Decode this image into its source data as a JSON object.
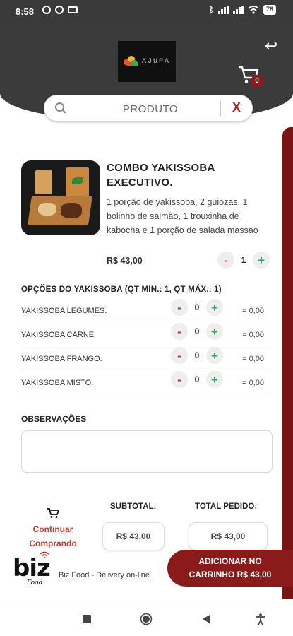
{
  "status_bar": {
    "time": "8:58",
    "battery": "78"
  },
  "header": {
    "logo_text": "AJUPA",
    "cart_count": "0"
  },
  "search": {
    "placeholder": "PRODUTO",
    "clear_label": "X"
  },
  "product": {
    "title": "COMBO YAKISSOBA EXECUTIVO.",
    "description": "1 porção de yakissoba, 2 guiozas, 1 bolinho de salmão, 1 trouxinha de kabocha e 1 porção de salada massao",
    "price": "R$ 43,00",
    "quantity": "1"
  },
  "options": {
    "title": "OPÇÕES DO YAKISSOBA (QT MIN.: 1, QT MÁX.: 1)",
    "items": [
      {
        "name": "YAKISSOBA LEGUMES.",
        "qty": "0",
        "total": "= 0,00"
      },
      {
        "name": "YAKISSOBA CARNE.",
        "qty": "0",
        "total": "= 0,00"
      },
      {
        "name": "YAKISSOBA FRANGO.",
        "qty": "0",
        "total": "= 0,00"
      },
      {
        "name": "YAKISSOBA MISTO.",
        "qty": "0",
        "total": "= 0,00"
      }
    ]
  },
  "observations": {
    "title": "OBSERVAÇÕES"
  },
  "footer": {
    "continue_line1": "Continuar",
    "continue_line2": "Comprando",
    "subtotal_label": "SUBTOTAL:",
    "subtotal_value": "R$ 43,00",
    "total_label": "TOTAL PEDIDO:",
    "total_value": "R$ 43,00",
    "add_line1": "ADICIONAR NO",
    "add_line2": "CARRINHO R$ 43,00",
    "brand_word": "biz",
    "brand_sub": "Food",
    "tagline": "Biz Food - Delivery on-line"
  },
  "colors": {
    "accent": "#8b1a1a",
    "header": "#3b3b3b",
    "minus": "#c0392b",
    "plus": "#27a35a"
  }
}
